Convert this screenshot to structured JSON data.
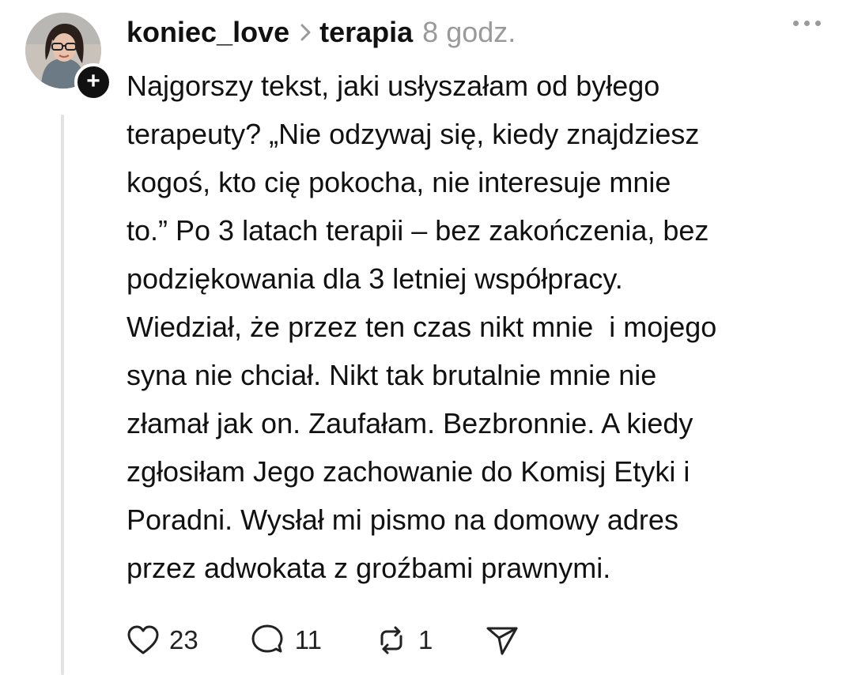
{
  "post": {
    "username": "koniec_love",
    "topic": "terapia",
    "time": "8 godz.",
    "text_lines": [
      "Najgorszy tekst, jaki usłyszałam od byłego",
      "terapeuty? „Nie odzywaj się, kiedy znajdziesz",
      "kogoś, kto cię pokocha, nie interesuje mnie",
      "to.” Po 3 latach terapii – bez zakończenia, bez",
      "podziękowania dla 3 letniej współpracy.",
      "Wiedział, że przez ten czas nikt mnie  i mojego",
      "syna nie chciał. Nikt tak brutalnie mnie nie",
      "złamał jak on. Zaufałam. Bezbronnie. A kiedy",
      "zgłosiłam Jego zachowanie do Komisj Etyki i",
      "Poradni. Wysłał mi pismo na domowy adres",
      "przez adwokata z groźbami prawnymi."
    ],
    "follow_badge": "+"
  },
  "actions": {
    "likes": "23",
    "replies": "11",
    "reposts": "1"
  },
  "icons": {
    "like": "heart-icon",
    "reply": "comment-icon",
    "repost": "repost-icon",
    "share": "send-icon",
    "more": "more-icon",
    "separator": "chevron-right-icon"
  },
  "colors": {
    "text": "#111111",
    "muted": "#9a9a9a",
    "thread_line": "#e3e3e3",
    "badge": "#111111"
  }
}
